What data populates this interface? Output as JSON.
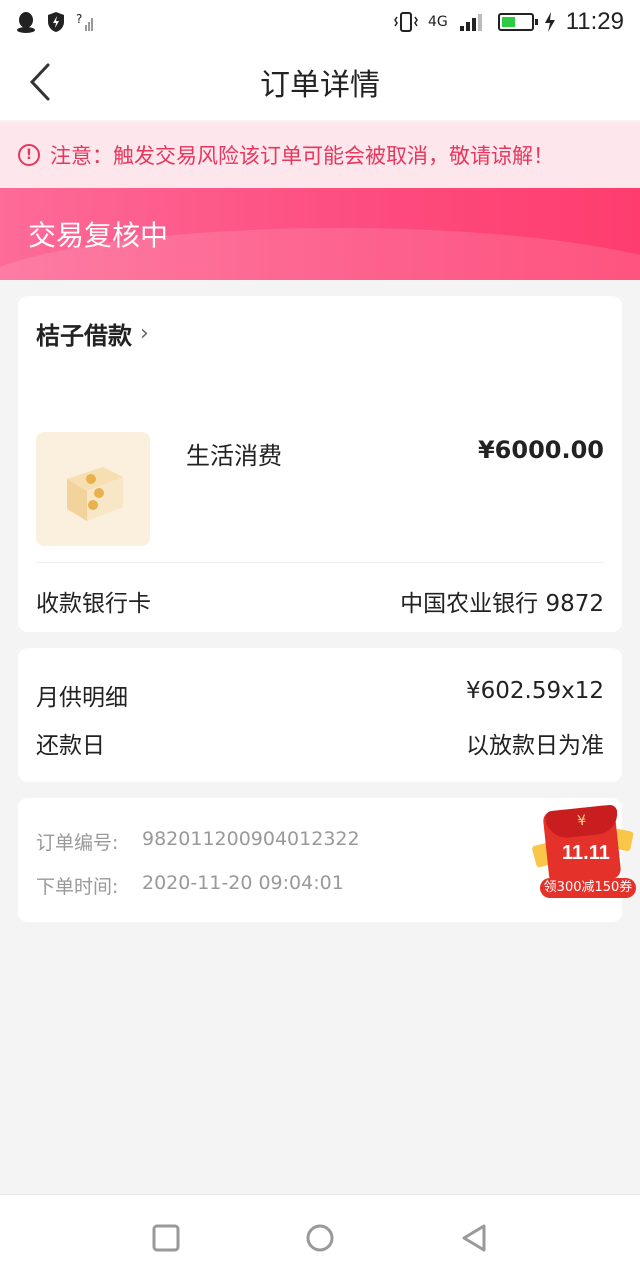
{
  "status_bar": {
    "time": "11:29",
    "network": "4G",
    "icons": [
      "qq-icon",
      "shield-icon",
      "no-signal-icon",
      "vibrate-icon",
      "network-4g-icon",
      "signal-icon",
      "battery-icon",
      "charging-icon"
    ],
    "battery_level": 0.45
  },
  "nav": {
    "title": "订单详情",
    "back_icon": "chevron-left-icon"
  },
  "notice": {
    "text": "注意：触发交易风险该订单可能会被取消，敬请谅解！",
    "color": "#e8365d"
  },
  "banner": {
    "status": "交易复核中",
    "color": "#fd4b7d"
  },
  "order": {
    "lender": "桔子借款",
    "product_name": "生活消费",
    "amount": "¥6000.00",
    "bank_label": "收款银行卡",
    "bank_value": "中国农业银行 9872"
  },
  "repayment": {
    "monthly_label": "月供明细",
    "monthly_value": "¥602.59x12",
    "due_label": "还款日",
    "due_value": "以放款日为准"
  },
  "meta": {
    "order_no_label": "订单编号:",
    "order_no": "982011200904012322",
    "order_time_label": "下单时间:",
    "order_time": "2020-11-20 09:04:01"
  },
  "promo": {
    "badge": "11.11",
    "currency": "¥",
    "label": "领300减150券"
  },
  "system_nav": [
    "square-icon",
    "circle-icon",
    "triangle-back-icon"
  ]
}
